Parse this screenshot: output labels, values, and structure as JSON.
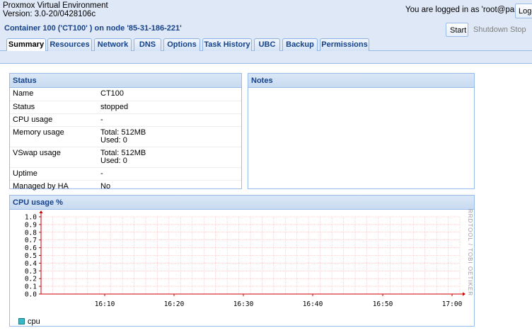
{
  "header": {
    "app_name": "Proxmox Virtual Environment",
    "version": "Version: 3.0-20/0428106c",
    "login_text": "You are logged in as 'root@pam'",
    "logout_label": "Logout"
  },
  "container": {
    "title": "Container 100 ('CT100' ) on node '85-31-186-221'",
    "buttons": {
      "start": "Start",
      "shutdown": "Shutdown",
      "stop": "Stop"
    }
  },
  "tabs": [
    {
      "label": "Summary",
      "active": true
    },
    {
      "label": "Resources"
    },
    {
      "label": "Network"
    },
    {
      "label": "DNS"
    },
    {
      "label": "Options"
    },
    {
      "label": "Task History"
    },
    {
      "label": "UBC"
    },
    {
      "label": "Backup"
    },
    {
      "label": "Permissions"
    }
  ],
  "status_panel": {
    "title": "Status",
    "rows": [
      {
        "key": "Name",
        "value": "CT100"
      },
      {
        "key": "Status",
        "value": "stopped"
      },
      {
        "key": "CPU usage",
        "value": "-"
      },
      {
        "key": "Memory usage",
        "value": "Total: 512MB",
        "value2": "Used: 0"
      },
      {
        "key": "VSwap usage",
        "value": "Total: 512MB",
        "value2": "Used: 0"
      },
      {
        "key": "Uptime",
        "value": "-"
      },
      {
        "key": "Managed by HA",
        "value": "No"
      }
    ]
  },
  "notes_panel": {
    "title": "Notes"
  },
  "chart_panel": {
    "title": "CPU usage %",
    "side_text": "RRDTOOL / TOBI OETIKER"
  },
  "colors": {
    "series": "#37b7c8",
    "grid": "#f2b6b6",
    "axis": "#cc0000"
  },
  "chart_data": {
    "type": "line",
    "title": "CPU usage %",
    "x_ticks": [
      "16:10",
      "16:20",
      "16:30",
      "16:40",
      "16:50",
      "17:00"
    ],
    "y_ticks": [
      "1.0",
      "0.9",
      "0.8",
      "0.7",
      "0.6",
      "0.5",
      "0.4",
      "0.3",
      "0.2",
      "0.1",
      "0.0"
    ],
    "ylim": [
      0,
      1
    ],
    "grid": true,
    "legend": "bottom-left",
    "series": [
      {
        "name": "cpu",
        "values": []
      }
    ]
  }
}
